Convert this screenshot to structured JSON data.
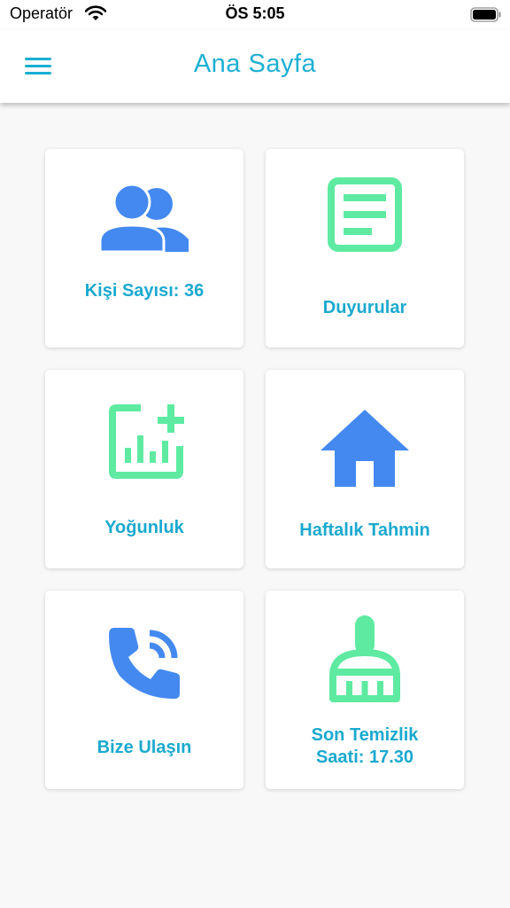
{
  "status_bar": {
    "carrier": "Operatör",
    "time": "ÖS 5:05"
  },
  "app_bar": {
    "title": "Ana Sayfa",
    "menu_icon": "menu-icon"
  },
  "colors": {
    "accent": "#1eb0d4",
    "label": "#1ba9cf",
    "blue_icon": "#4489f0",
    "green_icon": "#5eeaa1",
    "background": "#f8f8f8"
  },
  "cards": [
    {
      "label": "Kişi Sayısı: 36",
      "icon": "people-icon"
    },
    {
      "label": "Duyurular",
      "icon": "article-icon"
    },
    {
      "label": "Yoğunluk",
      "icon": "add-chart-icon"
    },
    {
      "label": "Haftalık Tahmin",
      "icon": "home-icon"
    },
    {
      "label": "Bize Ulaşın",
      "icon": "phone-in-talk-icon"
    },
    {
      "label": "Son Temizlik Saati: 17.30",
      "icon": "cleaning-brush-icon"
    }
  ]
}
